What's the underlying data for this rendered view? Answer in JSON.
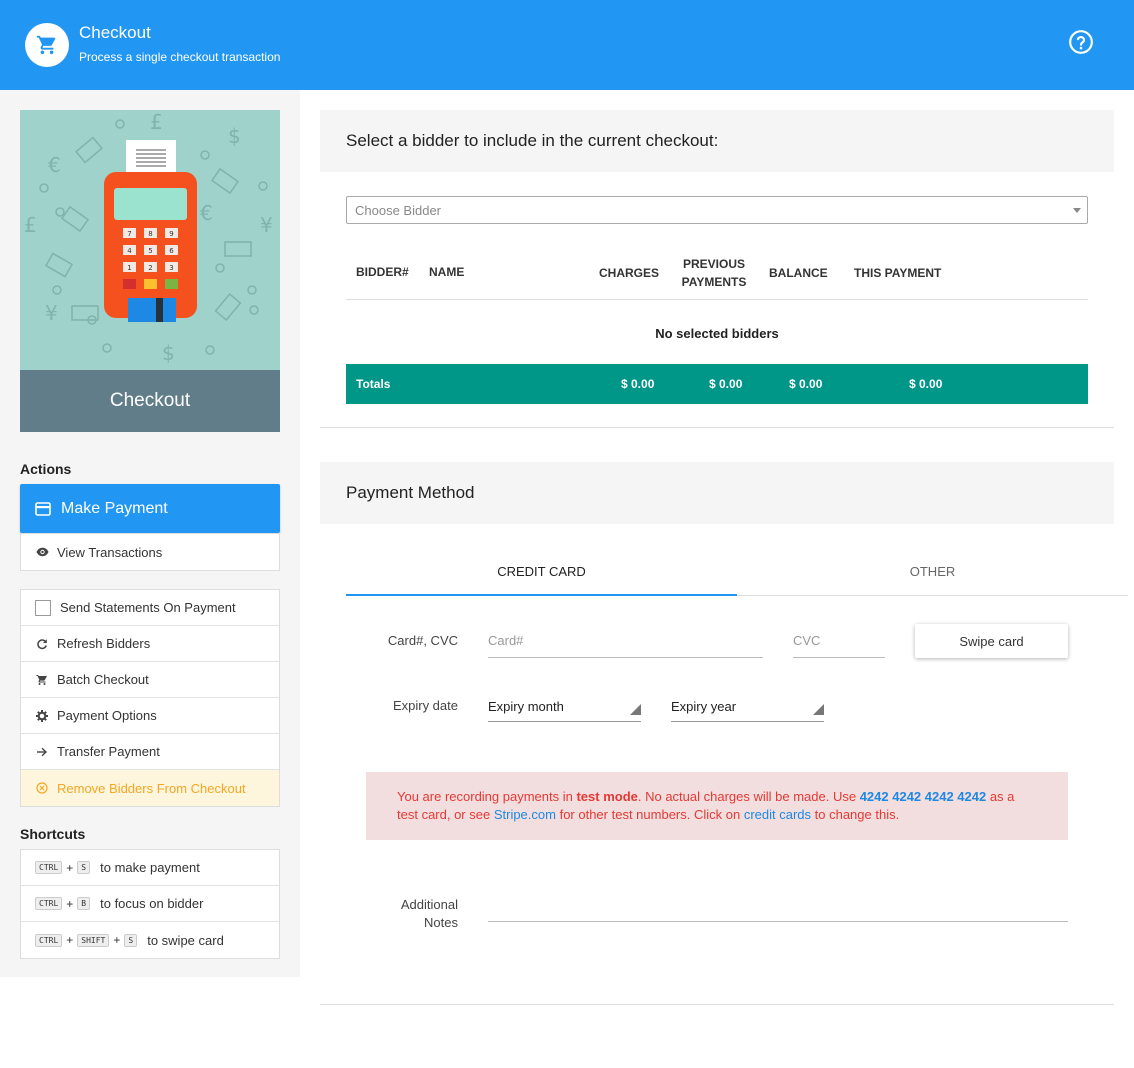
{
  "header": {
    "title": "Checkout",
    "subtitle": "Process a single checkout transaction",
    "logo_icon": "cart-icon",
    "help_icon": "help-circle-icon",
    "color": "#2196f3"
  },
  "sidebar": {
    "hero_caption": "Checkout",
    "actions_title": "Actions",
    "make_payment": "Make Payment",
    "view_transactions": "View Transactions",
    "options": {
      "send_statements": "Send Statements On Payment",
      "refresh_bidders": "Refresh Bidders",
      "batch_checkout": "Batch Checkout",
      "payment_options": "Payment Options",
      "transfer_payment": "Transfer Payment",
      "remove_bidders": "Remove Bidders From Checkout"
    },
    "shortcuts_title": "Shortcuts",
    "shortcuts": [
      {
        "keys": [
          "CTRL",
          "S"
        ],
        "text": "to make payment"
      },
      {
        "keys": [
          "CTRL",
          "B"
        ],
        "text": "to focus on bidder"
      },
      {
        "keys": [
          "CTRL",
          "SHIFT",
          "S"
        ],
        "text": "to swipe card"
      }
    ]
  },
  "bidder_panel": {
    "title": "Select a bidder to include in the current checkout:",
    "select_placeholder": "Choose Bidder",
    "columns": {
      "bidder": "BIDDER#",
      "name": "NAME",
      "charges": "CHARGES",
      "previous_payments_1": "PREVIOUS",
      "previous_payments_2": "PAYMENTS",
      "balance": "BALANCE",
      "this_payment": "THIS PAYMENT"
    },
    "empty_text": "No selected bidders",
    "totals": {
      "label": "Totals",
      "charges": "$ 0.00",
      "previous_payments": "$ 0.00",
      "balance": "$ 0.00",
      "this_payment": "$ 0.00"
    },
    "totals_color": "#009688"
  },
  "payment_panel": {
    "title": "Payment Method",
    "tabs": {
      "credit_card": "CREDIT CARD",
      "other": "OTHER"
    },
    "card_label": "Card#, CVC",
    "card_placeholder": "Card#",
    "cvc_placeholder": "CVC",
    "swipe_button": "Swipe card",
    "expiry_label": "Expiry date",
    "expiry_month": "Expiry month",
    "expiry_year": "Expiry year",
    "alert": {
      "p1": "You are recording payments in ",
      "mode": "test mode",
      "p2": ". No actual charges will be made. Use ",
      "test_card": "4242 4242 4242 4242",
      "p3": " as a test card, or see ",
      "stripe_link": "Stripe.com",
      "p4": " for other test numbers. Click on ",
      "cards_link": "credit cards",
      "p5": " to change this."
    },
    "notes_label_1": "Additional",
    "notes_label_2": "Notes"
  }
}
